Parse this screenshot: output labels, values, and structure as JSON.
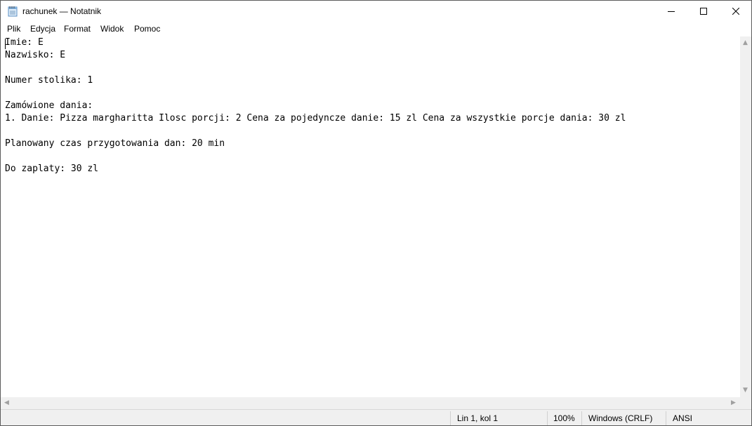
{
  "window": {
    "title": "rachunek — Notatnik",
    "icon": "notepad-icon",
    "controls": {
      "minimize_icon": "minimize-icon",
      "maximize_icon": "maximize-icon",
      "close_icon": "close-icon"
    }
  },
  "menu": {
    "items": [
      {
        "label": "Plik"
      },
      {
        "label": "Edycja"
      },
      {
        "label": "Format"
      },
      {
        "label": "Widok"
      },
      {
        "label": "Pomoc"
      }
    ]
  },
  "editor": {
    "content": "Imie: E\nNazwisko: E\n\nNumer stolika: 1\n\nZamówione dania:\n1. Danie: Pizza margharitta Ilosc porcji: 2 Cena za pojedyncze danie: 15 zl Cena za wszystkie porcje dania: 30 zl\n\nPlanowany czas przygotowania dan: 20 min\n\nDo zaplaty: 30 zl"
  },
  "status": {
    "position": "Lin 1, kol 1",
    "zoom": "100%",
    "line_ending": "Windows (CRLF)",
    "encoding": "ANSI"
  },
  "colors": {
    "window_border": "#5c5c5c",
    "chrome_background": "#f0f0f0",
    "editor_background": "#ffffff",
    "text": "#000000"
  }
}
